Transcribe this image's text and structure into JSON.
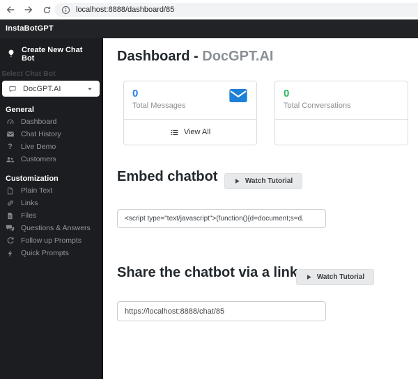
{
  "browser": {
    "url": "localhost:8888/dashboard/85"
  },
  "topbar": {
    "brand": "InstaBotGPT"
  },
  "sidebar": {
    "create_label": "Create New Chat Bot",
    "select_label": "Select Chat Bot",
    "bot_name": "DocGPT.AI",
    "sections": [
      {
        "title": "General",
        "items": [
          {
            "label": "Dashboard",
            "icon": "gauge-icon"
          },
          {
            "label": "Chat History",
            "icon": "envelope-icon"
          },
          {
            "label": "Live Demo",
            "icon": "question-icon"
          },
          {
            "label": "Customers",
            "icon": "users-icon"
          }
        ]
      },
      {
        "title": "Customization",
        "items": [
          {
            "label": "Plain Text",
            "icon": "file-icon"
          },
          {
            "label": "Links",
            "icon": "link-icon"
          },
          {
            "label": "Files",
            "icon": "files-icon"
          },
          {
            "label": "Questions & Answers",
            "icon": "comments-icon"
          },
          {
            "label": "Follow up Prompts",
            "icon": "redo-icon"
          },
          {
            "label": "Quick Prompts",
            "icon": "bolt-icon"
          }
        ]
      }
    ]
  },
  "main": {
    "title_prefix": "Dashboard - ",
    "title_bot": "DocGPT.AI",
    "stats": [
      {
        "value": "0",
        "label": "Total Messages",
        "accent": "#2780e3",
        "icon": "envelope-icon",
        "footer_label": "View All"
      },
      {
        "value": "0",
        "label": "Total Conversations",
        "accent": "#2eb85c"
      }
    ],
    "embed": {
      "heading": "Embed chatbot",
      "tutorial_label": "Watch Tutorial",
      "code": "<script type=\"text/javascript\">(function(){d=document;s=d."
    },
    "share": {
      "heading": "Share the chatbot via a link",
      "tutorial_label": "Watch Tutorial",
      "link": "https://localhost:8888/chat/85"
    }
  },
  "colors": {
    "accent_blue": "#2780e3",
    "accent_green": "#2eb85c",
    "sidebar_bg": "#1c1d21",
    "topbar_bg": "#212327"
  }
}
